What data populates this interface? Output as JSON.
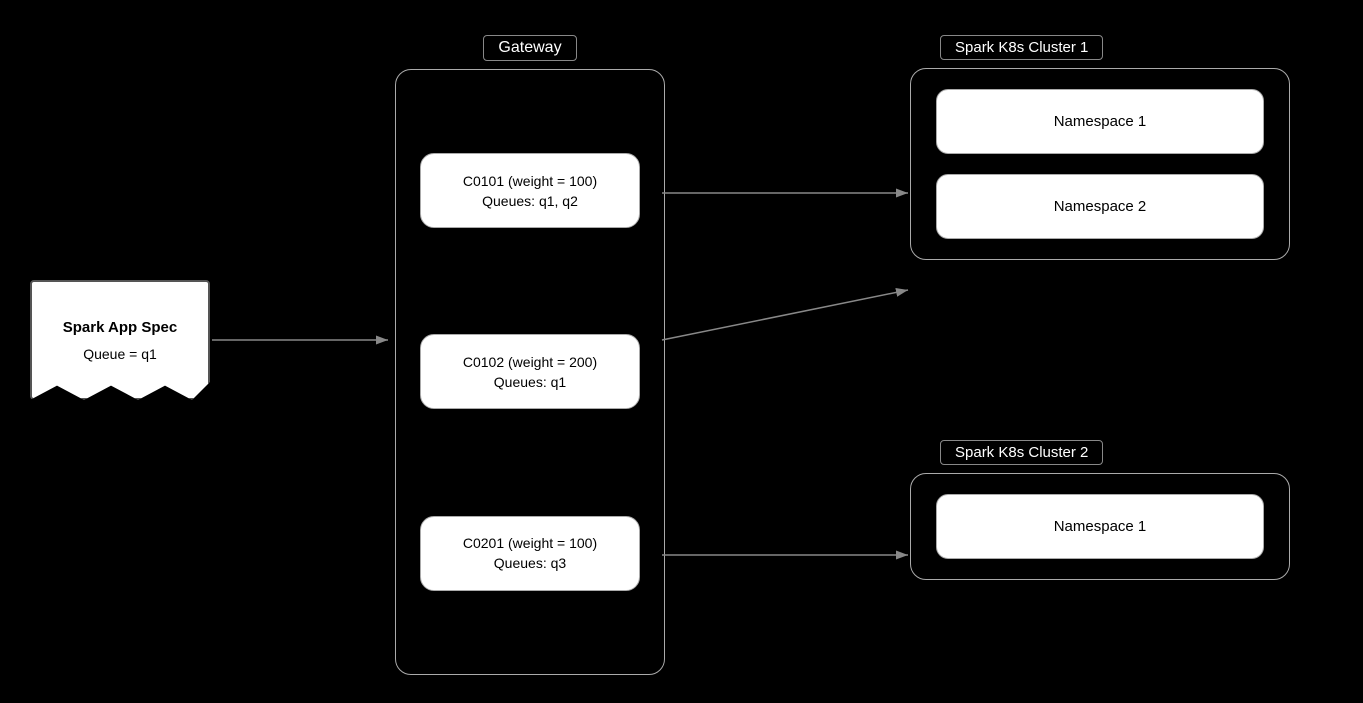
{
  "background": "#000000",
  "spark_app_spec": {
    "title": "Spark App Spec",
    "queue_label": "Queue = q1"
  },
  "gateway": {
    "label": "Gateway",
    "clusters": [
      {
        "id": "c0101",
        "title": "C0101 (weight = 100)",
        "queues": "Queues: q1, q2"
      },
      {
        "id": "c0102",
        "title": "C0102 (weight = 200)",
        "queues": "Queues: q1"
      },
      {
        "id": "c0201",
        "title": "C0201 (weight = 100)",
        "queues": "Queues: q3"
      }
    ]
  },
  "k8s_cluster_1": {
    "label": "Spark K8s Cluster 1",
    "namespaces": [
      "Namespace 1",
      "Namespace 2"
    ]
  },
  "k8s_cluster_2": {
    "label": "Spark K8s Cluster 2",
    "namespaces": [
      "Namespace 1"
    ]
  }
}
